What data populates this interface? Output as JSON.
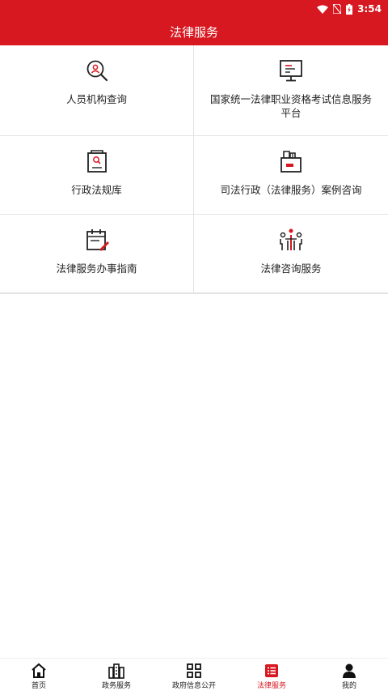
{
  "status": {
    "time": "3:54"
  },
  "header": {
    "title": "法律服务"
  },
  "grid": {
    "items": [
      {
        "label": "人员机构查询",
        "icon": "person-search-icon"
      },
      {
        "label": "国家统一法律职业资格考试信息服务平台",
        "icon": "monitor-icon"
      },
      {
        "label": "行政法规库",
        "icon": "document-search-icon"
      },
      {
        "label": "司法行政（法律服务）案例咨询",
        "icon": "folder-case-icon"
      },
      {
        "label": "法律服务办事指南",
        "icon": "calendar-pen-icon"
      },
      {
        "label": "法律咨询服务",
        "icon": "people-consult-icon"
      }
    ]
  },
  "tabs": [
    {
      "label": "首页",
      "icon": "home-icon"
    },
    {
      "label": "政务服务",
      "icon": "building-icon"
    },
    {
      "label": "政府信息公开",
      "icon": "grid-icon"
    },
    {
      "label": "法律服务",
      "icon": "list-icon",
      "active": true
    },
    {
      "label": "我的",
      "icon": "user-icon"
    }
  ],
  "colors": {
    "brand": "#d71820",
    "text": "#222222",
    "divider": "#e3e3e3"
  }
}
